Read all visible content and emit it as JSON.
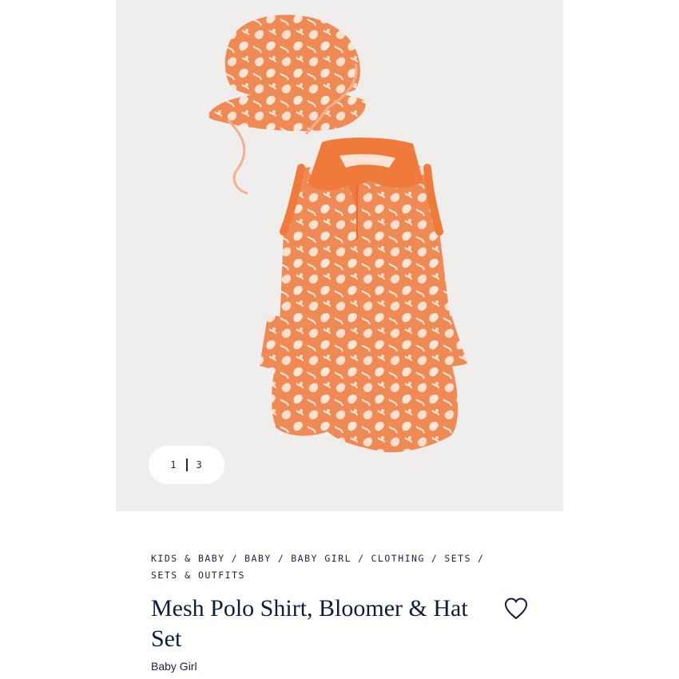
{
  "gallery": {
    "current_page": "1",
    "total_pages": "3"
  },
  "breadcrumb": {
    "items": [
      "KIDS & BABY",
      "BABY",
      "BABY GIRL",
      "CLOTHING",
      "SETS",
      "SETS & OUTFITS"
    ]
  },
  "product": {
    "title": "Mesh Polo Shirt, Bloomer & Hat Set",
    "subtitle": "Baby Girl"
  },
  "icons": {
    "wishlist": "heart-outline-icon"
  },
  "colors": {
    "product_orange": "#f08a55",
    "collar_orange": "#f07a3c",
    "text_navy": "#0f1c3c",
    "gallery_bg": "#efeeec"
  }
}
